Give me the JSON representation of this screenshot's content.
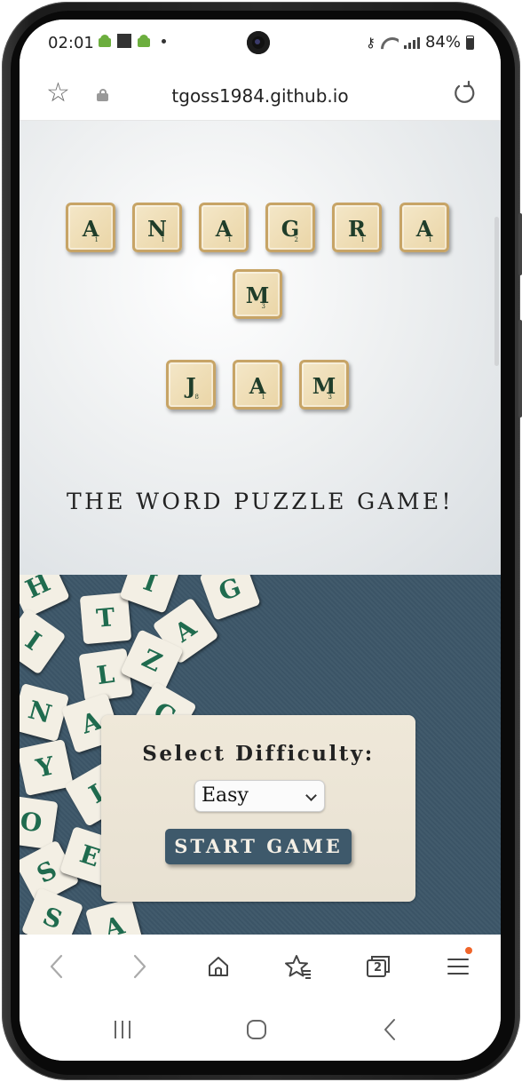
{
  "status_bar": {
    "time": "02:01",
    "battery": "84%"
  },
  "browser": {
    "url": "tgoss1984.github.io",
    "tab_count": "2"
  },
  "hero": {
    "title_word_1": [
      {
        "letter": "A",
        "points": "1"
      },
      {
        "letter": "N",
        "points": "1"
      },
      {
        "letter": "A",
        "points": "1"
      },
      {
        "letter": "G",
        "points": "2"
      },
      {
        "letter": "R",
        "points": "1"
      },
      {
        "letter": "A",
        "points": "1"
      },
      {
        "letter": "M",
        "points": "3"
      }
    ],
    "title_word_2": [
      {
        "letter": "J",
        "points": "8"
      },
      {
        "letter": "A",
        "points": "1"
      },
      {
        "letter": "M",
        "points": "3"
      }
    ],
    "tagline": "THE WORD PUZZLE GAME!"
  },
  "difficulty": {
    "label": "Select Difficulty:",
    "selected": "Easy",
    "start_label": "START GAME"
  },
  "icons": {
    "status": [
      "android-icon",
      "square-icon",
      "android-icon",
      "dot-icon",
      "key-icon",
      "wifi-icon",
      "signal-icon",
      "battery-icon"
    ],
    "browser": [
      "star-icon",
      "lock-icon",
      "reload-icon"
    ],
    "bottom_nav": [
      "back-arrow-icon",
      "forward-arrow-icon",
      "home-icon",
      "bookmarks-icon",
      "tabs-icon",
      "menu-icon"
    ],
    "system_nav": [
      "recent-apps-icon",
      "home-button-icon",
      "back-icon"
    ]
  },
  "colors": {
    "tile_face": "#f0e1bd",
    "tile_border": "#c7a466",
    "tile_text": "#1f3d2a",
    "board_blue": "#3d5769",
    "button_bg": "#3e596b",
    "notify_dot": "#f0652a"
  }
}
